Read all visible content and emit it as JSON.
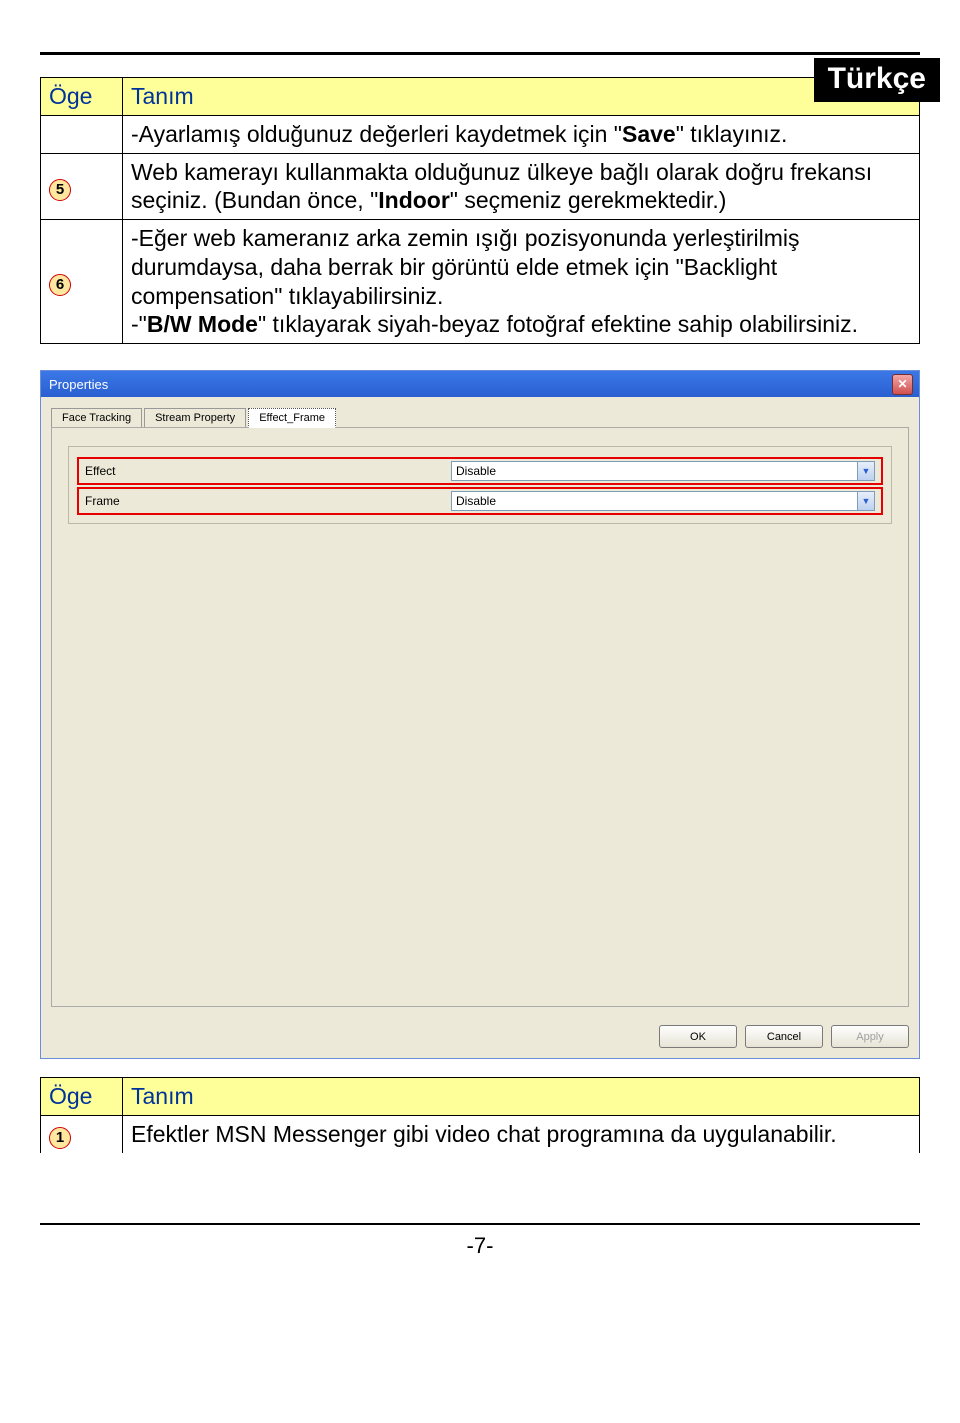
{
  "lang_badge": "Türkçe",
  "table1": {
    "head_oge": "Öge",
    "head_tanim": "Tanım",
    "row_save": {
      "pre": "-Ayarlamış olduğunuz değerleri kaydetmek için \"",
      "bold": "Save",
      "post": "\" tıklayınız."
    },
    "row5": {
      "num": "5",
      "pre": "Web kamerayı kullanmakta olduğunuz ülkeye bağlı olarak doğru frekansı seçiniz. (Bundan önce, \"",
      "bold": "Indoor",
      "post": "\" seçmeniz gerekmektedir.)"
    },
    "row6": {
      "num": "6",
      "line1": "-Eğer web kameranız arka zemin ışığı pozisyonunda yerleştirilmiş durumdaysa, daha berrak bir görüntü elde etmek için \"Backlight compensation\" tıklayabilirsiniz.",
      "line2_pre": "-\"",
      "line2_bold": "B/W Mode",
      "line2_post": "\" tıklayarak siyah-beyaz fotoğraf efektine sahip olabilirsiniz."
    }
  },
  "dialog": {
    "title": "Properties",
    "tabs": {
      "t1": "Face Tracking",
      "t2": "Stream Property",
      "t3": "Effect_Frame"
    },
    "effect_label": "Effect",
    "frame_label": "Frame",
    "effect_value": "Disable",
    "frame_value": "Disable",
    "ok": "OK",
    "cancel": "Cancel",
    "apply": "Apply"
  },
  "table2": {
    "head_oge": "Öge",
    "head_tanim": "Tanım",
    "row1": {
      "num": "1",
      "text": "Efektler MSN Messenger gibi video chat programına da uygulanabilir."
    }
  },
  "page_number": "-7-"
}
